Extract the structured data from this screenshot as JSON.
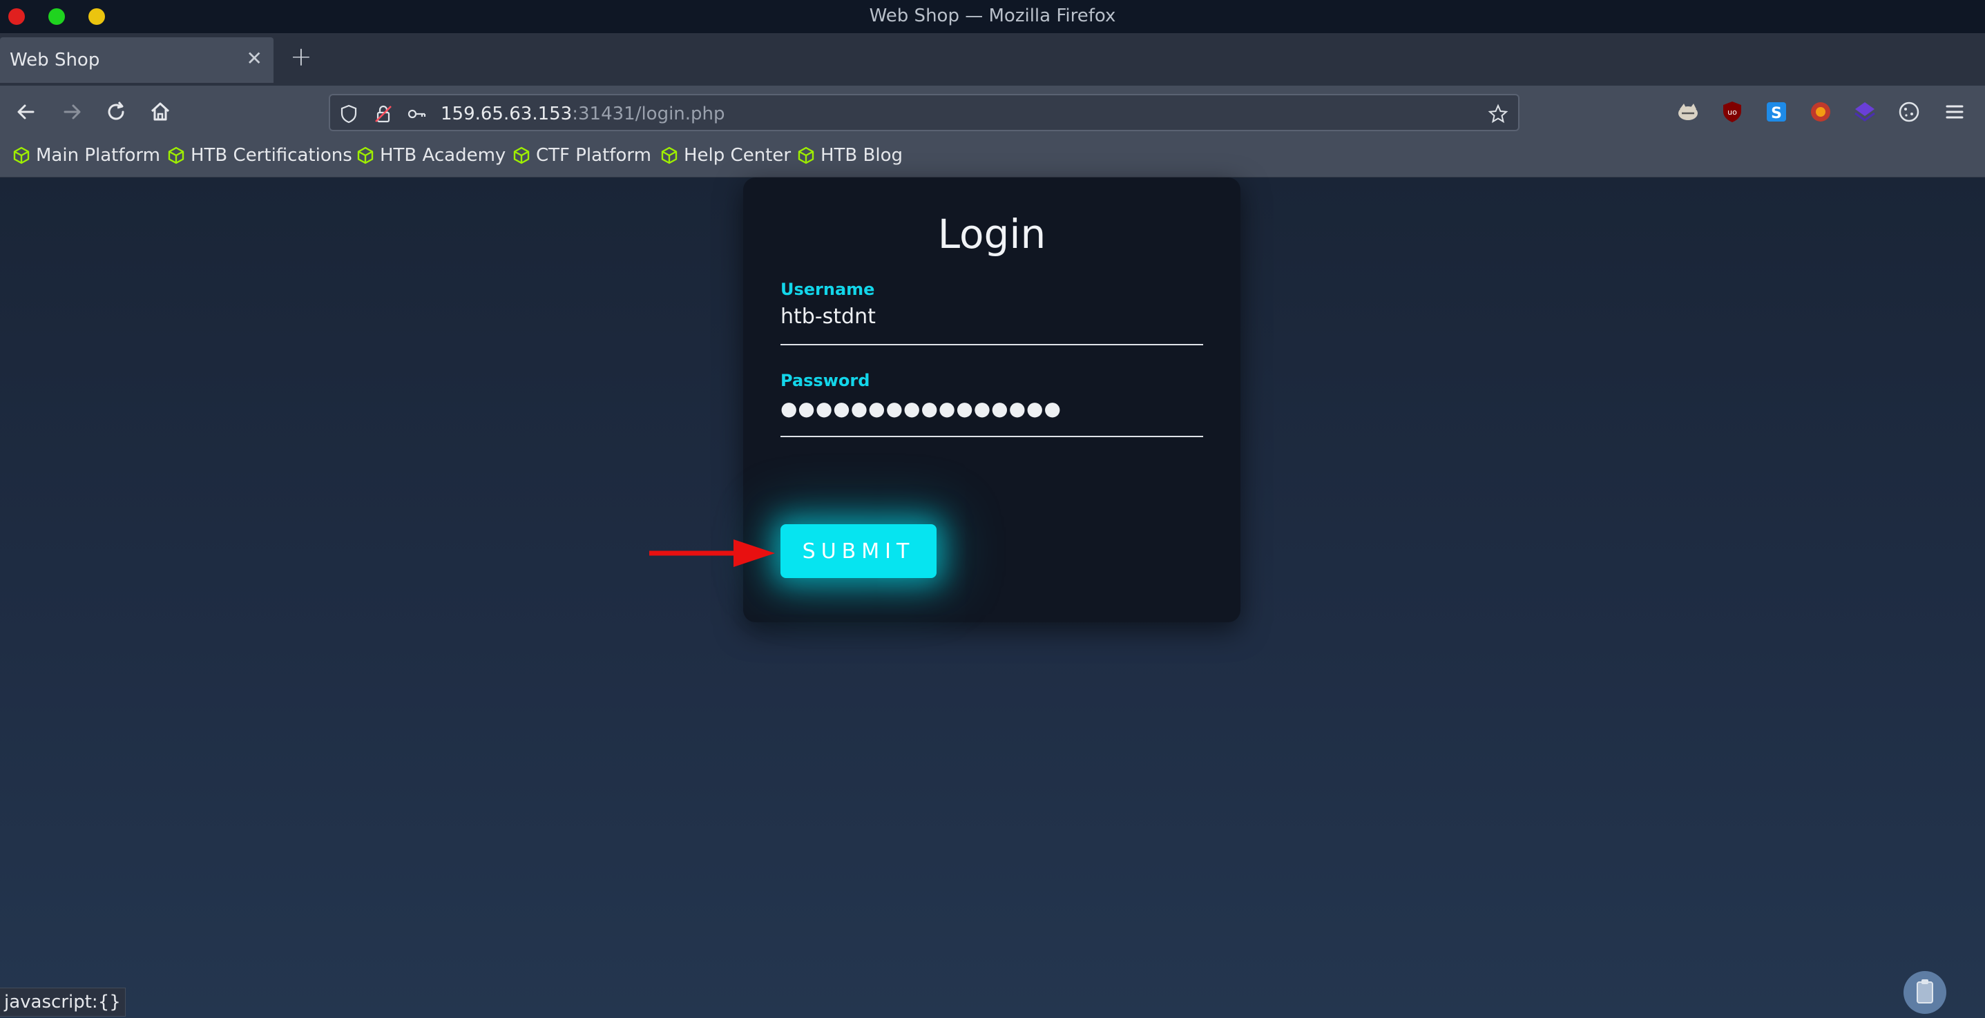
{
  "window": {
    "title": "Web Shop — Mozilla Firefox"
  },
  "tab": {
    "title": "Web Shop",
    "close": "✕",
    "new_tab": "+"
  },
  "urlbar": {
    "host": "159.65.63.153",
    "rest": ":31431/login.php"
  },
  "bookmarks": [
    {
      "label": "Main Platform"
    },
    {
      "label": "HTB Certifications"
    },
    {
      "label": "HTB Academy"
    },
    {
      "label": "CTF Platform"
    },
    {
      "label": "Help Center"
    },
    {
      "label": "HTB Blog"
    }
  ],
  "login": {
    "title": "Login",
    "username_label": "Username",
    "username_value": "htb-stdnt",
    "password_label": "Password",
    "password_value": "●●●●●●●●●●●●●●●●",
    "submit_label": "SUBMIT"
  },
  "status": {
    "text": "javascript:{}"
  },
  "colors": {
    "accent": "#06e4f0",
    "label": "#13d6ea",
    "bookmark_icon": "#9fef00",
    "arrow": "#e81010"
  }
}
